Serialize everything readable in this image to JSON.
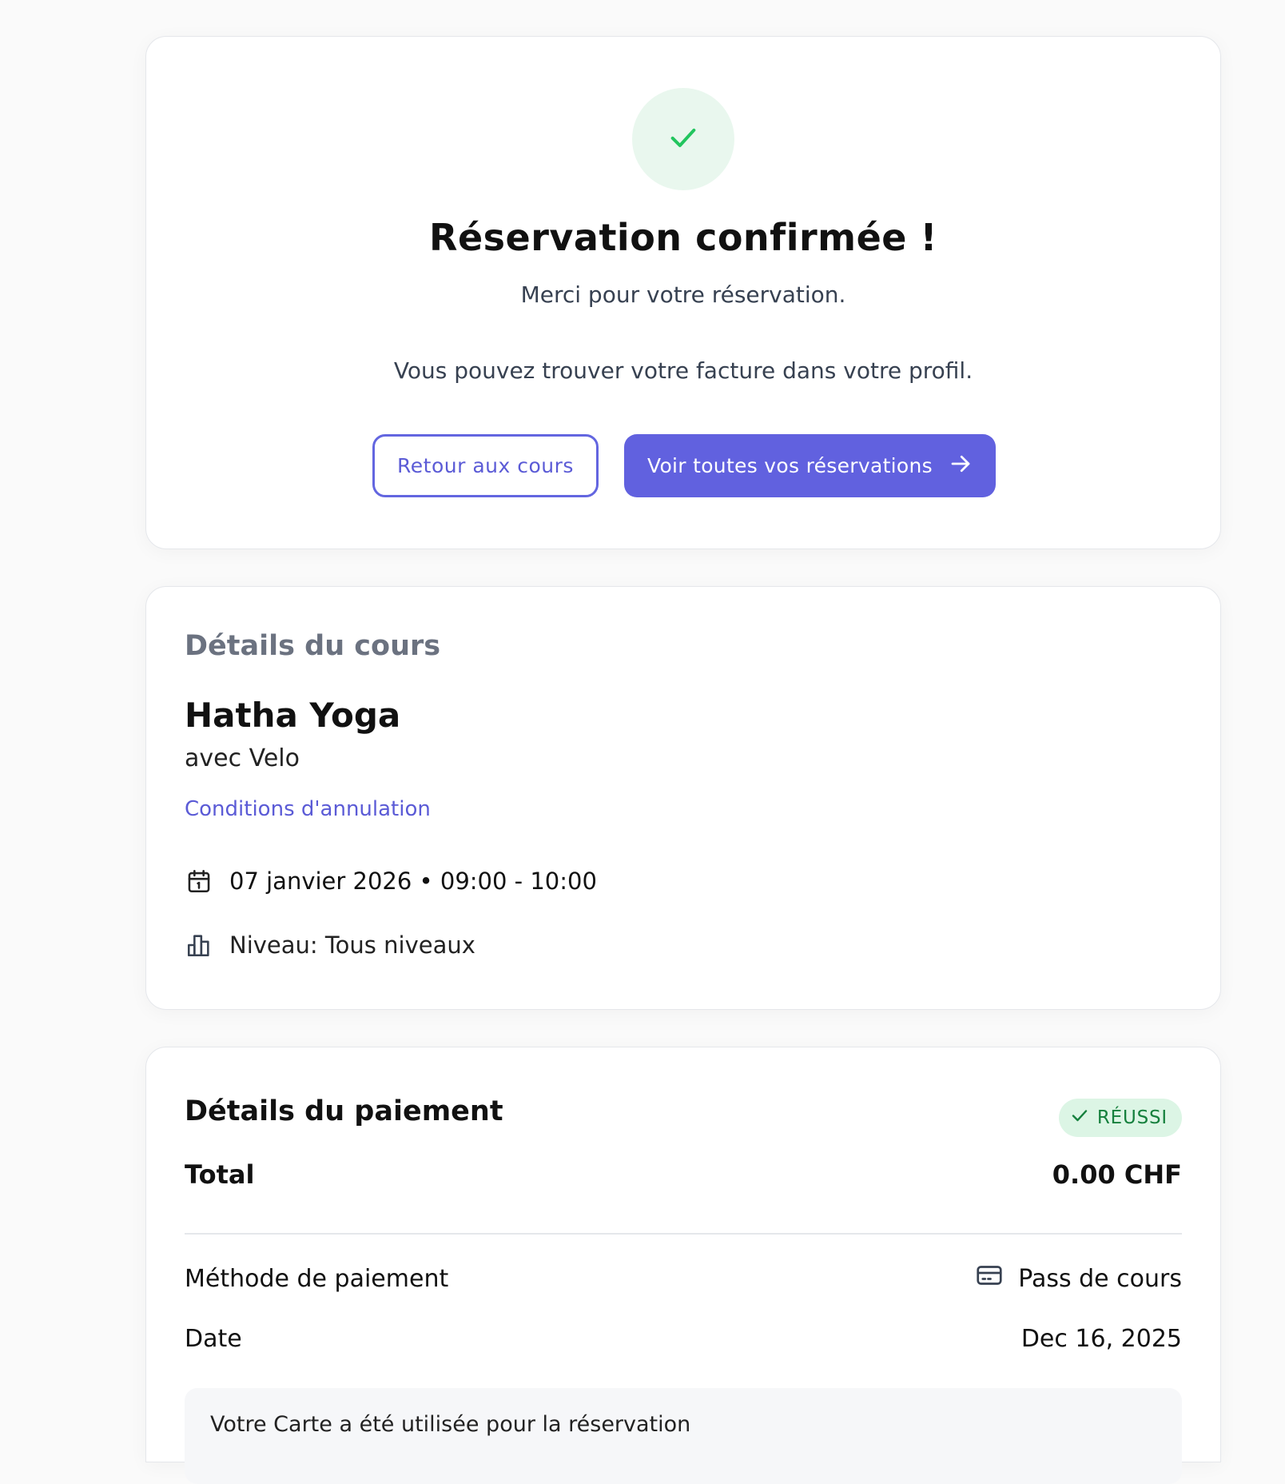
{
  "confirmation": {
    "title": "Réservation confirmée !",
    "thanks": "Merci pour votre réservation.",
    "invoice_note": "Vous pouvez trouver votre facture dans votre profil.",
    "back_button": "Retour aux cours",
    "all_bookings_button": "Voir toutes vos réservations",
    "icons": {
      "success": "check-icon",
      "arrow": "arrow-right-icon"
    }
  },
  "course": {
    "section_title": "Détails du cours",
    "name": "Hatha Yoga",
    "teacher": "avec Velo",
    "cancellation_link": "Conditions d'annulation",
    "datetime": "07 janvier 2026 • 09:00 - 10:00",
    "level": "Niveau: Tous niveaux",
    "icons": {
      "date": "calendar-icon",
      "level": "bar-chart-icon"
    }
  },
  "payment": {
    "section_title": "Détails du paiement",
    "status": "RÉUSSI",
    "total_label": "Total",
    "total_value": "0.00 CHF",
    "method_label": "Méthode de paiement",
    "method_value": "Pass de cours",
    "date_label": "Date",
    "date_value": "Dec 16, 2025",
    "note": "Votre Carte a été utilisée pour la réservation",
    "icons": {
      "status": "check-icon",
      "method": "credit-card-icon"
    }
  },
  "colors": {
    "accent": "#6161df",
    "success": "#22c55e",
    "success_bg": "#e9f7ee",
    "badge_bg": "#dcf5e5",
    "badge_text": "#15803d",
    "muted": "#6b7280"
  }
}
